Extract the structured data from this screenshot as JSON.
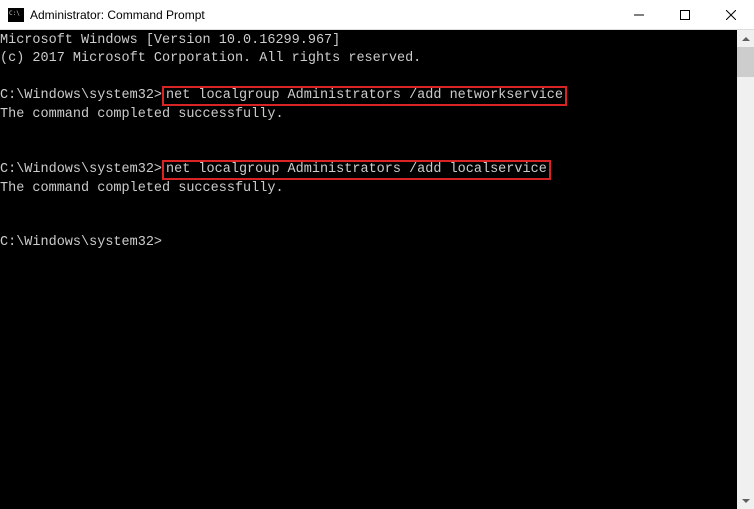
{
  "titlebar": {
    "title": "Administrator: Command Prompt"
  },
  "terminal": {
    "line1": "Microsoft Windows [Version 10.0.16299.967]",
    "line2": "(c) 2017 Microsoft Corporation. All rights reserved.",
    "prompt1_prefix": "C:\\Windows\\system32>",
    "command1": "net localgroup Administrators /add networkservice",
    "result1": "The command completed successfully.",
    "prompt2_prefix": "C:\\Windows\\system32>",
    "command2": "net localgroup Administrators /add localservice",
    "result2": "The command completed successfully.",
    "prompt3": "C:\\Windows\\system32>"
  }
}
